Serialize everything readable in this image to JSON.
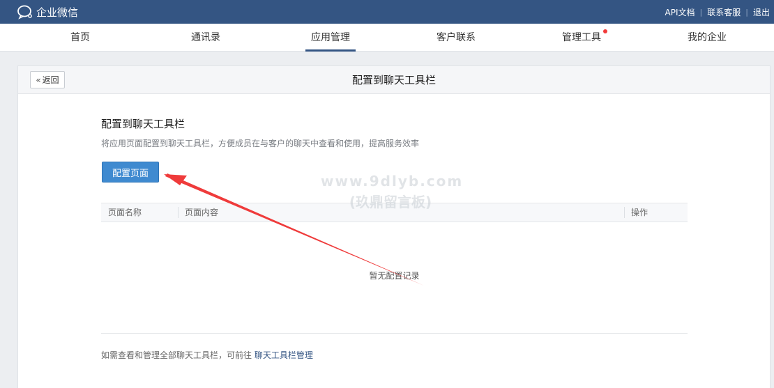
{
  "app": {
    "name": "企业微信"
  },
  "top_links": [
    {
      "label": "API文档"
    },
    {
      "label": "联系客服"
    },
    {
      "label": "退出"
    }
  ],
  "nav": {
    "items": [
      {
        "label": "首页"
      },
      {
        "label": "通讯录"
      },
      {
        "label": "应用管理",
        "active": true
      },
      {
        "label": "客户联系"
      },
      {
        "label": "管理工具",
        "badge": true
      },
      {
        "label": "我的企业"
      }
    ]
  },
  "header": {
    "back_label": "返回",
    "title": "配置到聊天工具栏"
  },
  "section": {
    "title": "配置到聊天工具栏",
    "description": "将应用页面配置到聊天工具栏，方便成员在与客户的聊天中查看和使用，提高服务效率",
    "button_label": "配置页面"
  },
  "table": {
    "columns": [
      "页面名称",
      "页面内容",
      "操作"
    ],
    "empty_text": "暂无配置记录"
  },
  "footer": {
    "note": "如需查看和管理全部聊天工具栏，可前往",
    "link": "聊天工具栏管理"
  },
  "watermark": {
    "line1": "www.9dlyb.com",
    "line2": "(玖鼎留言板)"
  },
  "colors": {
    "topbar": "#345583",
    "primary": "#3f8ad0",
    "badge": "#f23a3a",
    "annotation_arrow": "#ef3b3b"
  }
}
